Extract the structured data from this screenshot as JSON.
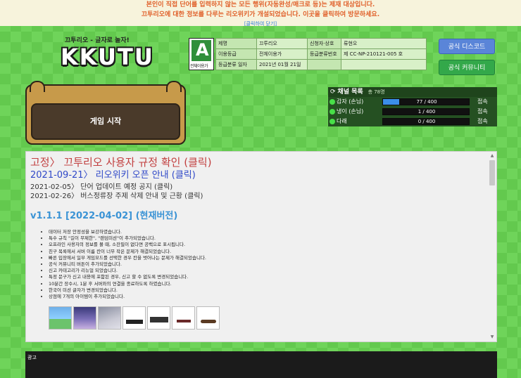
{
  "notice": {
    "line1": "본인이 직접 단어를 입력하지 않는 모든 행위(자동완성/매크로 등)는 제재 대상입니다.",
    "line2": "끄투리오에 대한 정보를 다루는 리오위키가 개설되었습니다. 이곳을 클릭하여 방문하세요.",
    "close": "[클릭하여 닫기]"
  },
  "logo": {
    "sub": "끄투리오 - 글자로 놀자!",
    "main": "KKUTU"
  },
  "rating": {
    "mark": "A",
    "caption": "전체이용가"
  },
  "info": {
    "rows": [
      {
        "k1": "제명",
        "v1": "끄투리오",
        "k2": "신청자·상호",
        "v2": "류현오"
      },
      {
        "k1": "이용등급",
        "v1": "전체이용가",
        "k2": "등급분류번호",
        "v2": "제 CC-NP-210121-005 호"
      },
      {
        "k1": "등급분류 일자",
        "v1": "2021년 01월 21일",
        "k2": "",
        "v2": ""
      }
    ]
  },
  "buttons": {
    "discord": "공식 디스코드",
    "community": "공식 커뮤니티"
  },
  "start": {
    "label": "게임 시작"
  },
  "channels": {
    "title": "채널 목록",
    "total": "총 78명",
    "rows": [
      {
        "name": "감자 (손님)",
        "count": "77 / 400",
        "level": 0.19,
        "action": "접속"
      },
      {
        "name": "냉이 (손님)",
        "count": "1 / 400",
        "level": 0.0,
        "action": "접속"
      },
      {
        "name": "다래",
        "count": "0 / 400",
        "level": 0.0,
        "action": "접속"
      }
    ]
  },
  "board": {
    "line1": "고정〉 끄투리오 사용자 규정 확인 (클릭)",
    "line2": "2021-09-21〉 리오위키 오픈 안내 (클릭)",
    "line3": "2021-02-05〉 단어 업데이트 예정 공지 (클릭)",
    "line4": "2021-02-26〉 버스정류장 주제 삭제 안내 및 근황 (클릭)",
    "version": "v1.1.1 [2022-04-02] (현재버전)",
    "items": [
      "데이터 저장 안정성을 보강하였습니다.",
      "특수 규칙 \"길이 무제한\", \"랜덤미션\"이 추가되었습니다.",
      "오프라인 사용자의 정보를 볼 때, 소잔필이 없다면 공백으로 표시됩니다.",
      "친구 목록에서 서버 이름 칸이 너무 작은 문제가 해결되었습니다.",
      "빠른 입장에서 일부 게임모드를 선택한 경우 칸을 벗어나는 문제가 해결되었습니다.",
      "공식 커뮤니티 버튼이 추가되었습니다.",
      "신고 카테고리가 리뉴얼 되었습니다.",
      "특정 문구가 신고 내용에 포함된 경우, 신고 할 수 없도록 변경되었습니다.",
      "10분간 장수시, 1분 후 서버와의 연결을 종료하도록 하였습니다.",
      "한국어 미션 글자가 변경되었습니다.",
      "상점에 7개의 아이템이 추가되었습니다."
    ]
  },
  "ad": {
    "label": "광고"
  }
}
